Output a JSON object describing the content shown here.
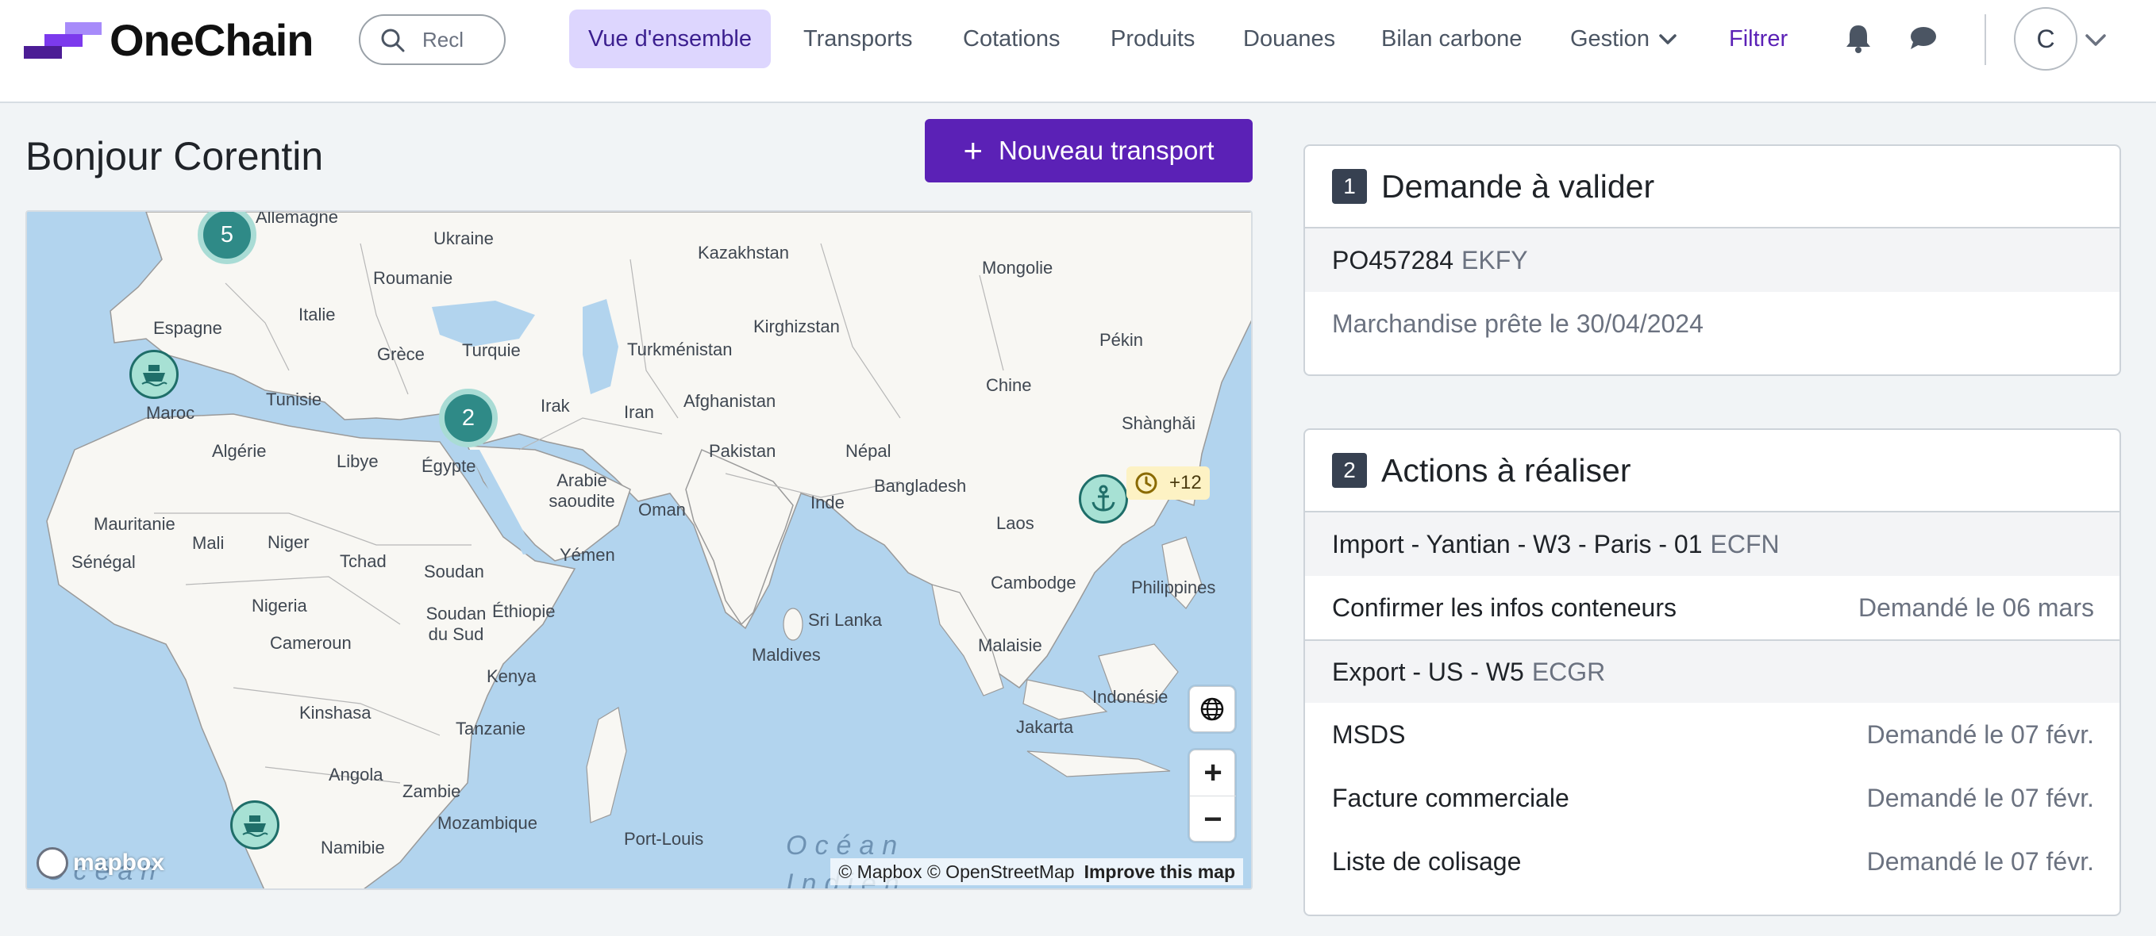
{
  "app": {
    "name": "OneChain",
    "brand_colors": {
      "primary": "#5b21b6",
      "logo_light": "#a78bfa",
      "logo_dark": "#4c1d95"
    }
  },
  "header": {
    "search": {
      "placeholder": "Rech",
      "value": "Recl"
    },
    "nav": [
      {
        "label": "Vue d'ensemble",
        "active": true
      },
      {
        "label": "Transports"
      },
      {
        "label": "Cotations"
      },
      {
        "label": "Produits"
      },
      {
        "label": "Douanes"
      },
      {
        "label": "Bilan carbone"
      },
      {
        "label": "Gestion",
        "has_dropdown": true
      }
    ],
    "filter_label": "Filtrer",
    "icons": [
      "bell-icon",
      "chat-icon"
    ],
    "avatar_initial": "C"
  },
  "main": {
    "greeting": "Bonjour Corentin",
    "new_transport_label": "Nouveau transport"
  },
  "map": {
    "labels": [
      "Allemagne",
      "Ukraine",
      "Kazakhstan",
      "Mongolie",
      "Roumanie",
      "Espagne",
      "Italie",
      "Kirghizstan",
      "Pékin",
      "Grèce",
      "Turquie",
      "Turkménistan",
      "Chine",
      "Maroc",
      "Tunisie",
      "Irak",
      "Iran",
      "Afghanistan",
      "Shànghǎi",
      "Algérie",
      "Libye",
      "Égypte",
      "Pakistan",
      "Népal",
      "Bangladesh",
      "Arabie saoudite",
      "Oman",
      "Inde",
      "Laos",
      "Mauritanie",
      "Mali",
      "Niger",
      "Sénégal",
      "Tchad",
      "Yémen",
      "Soudan",
      "Cambodge",
      "Philippines",
      "Nigeria",
      "Soudan du Sud",
      "Éthiopie",
      "Sri Lanka",
      "Cameroun",
      "Malaisie",
      "Maldives",
      "Kenya",
      "Indonésie",
      "Kinshasa",
      "Tanzanie",
      "Jakarta",
      "Angola",
      "Zambie",
      "Mozambique",
      "Namibie",
      "Port-Louis",
      "Océan",
      "Indien",
      "Océan"
    ],
    "clusters": [
      {
        "count": "5"
      },
      {
        "count": "2"
      }
    ],
    "markers": [
      "ship-icon",
      "ship-icon",
      "anchor-icon"
    ],
    "alert_badge": "+12",
    "attribution": "© Mapbox © OpenStreetMap",
    "improve_label": "Improve this map",
    "logo_text": "mapbox"
  },
  "panels": {
    "validate": {
      "number": "1",
      "title": "Demande à valider",
      "item_ref": "PO457284",
      "item_code": "EKFY",
      "item_detail": "Marchandise prête le 30/04/2024"
    },
    "actions": {
      "number": "2",
      "title": "Actions à réaliser",
      "groups": [
        {
          "name": "Import - Yantian - W3 - Paris - 01",
          "code": "ECFN",
          "tasks": [
            {
              "label": "Confirmer les infos conteneurs",
              "date": "Demandé le 06 mars"
            }
          ]
        },
        {
          "name": "Export - US - W5",
          "code": "ECGR",
          "tasks": [
            {
              "label": "MSDS",
              "date": "Demandé le 07 févr."
            },
            {
              "label": "Facture commerciale",
              "date": "Demandé le 07 févr."
            },
            {
              "label": "Liste de colisage",
              "date": "Demandé le 07 févr."
            }
          ]
        }
      ]
    }
  }
}
